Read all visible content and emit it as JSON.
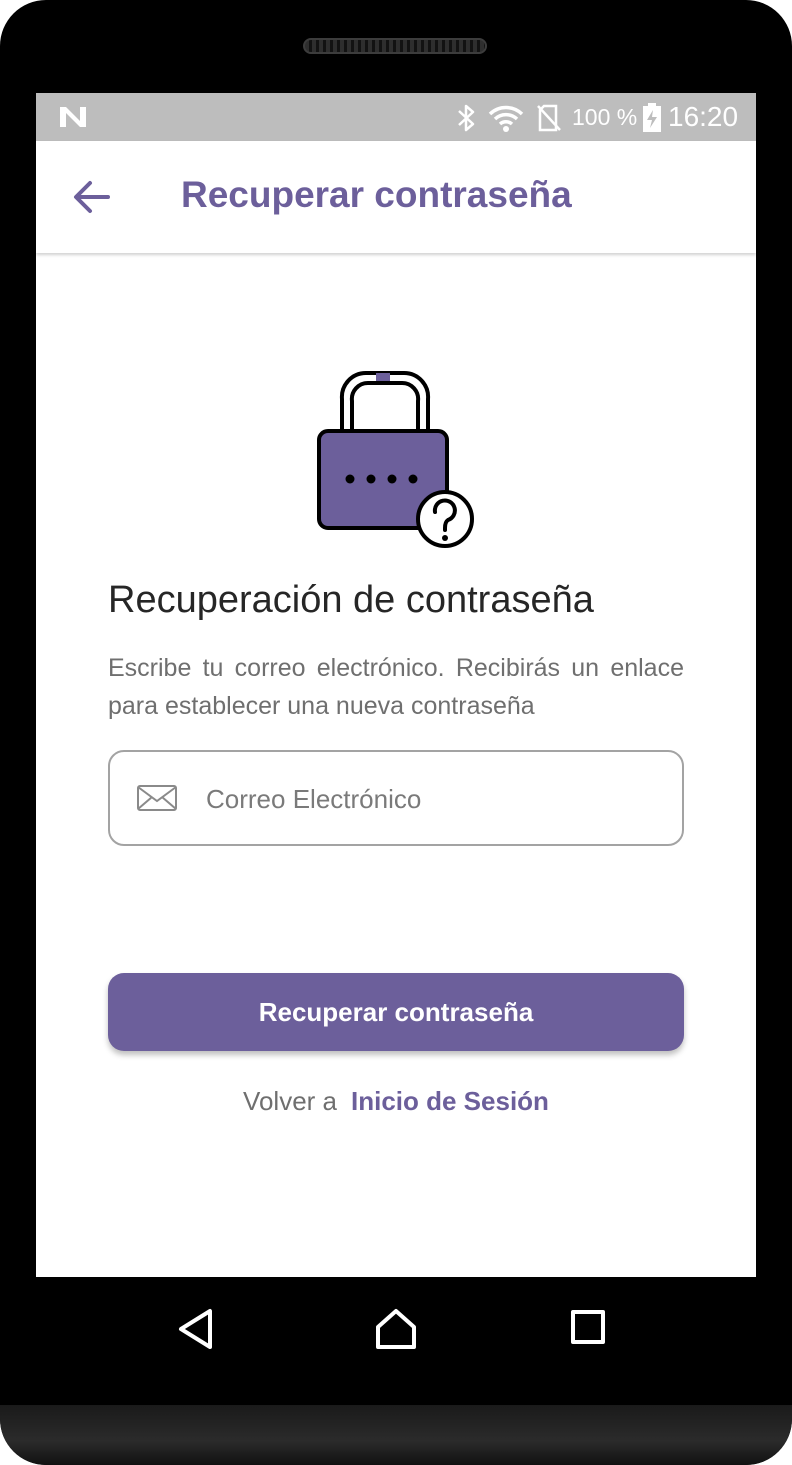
{
  "status_bar": {
    "battery_text": "100 %",
    "time": "16:20",
    "icons": [
      "n-notification-icon",
      "bluetooth-icon",
      "wifi-icon",
      "no-sim-icon",
      "battery-charging-icon"
    ]
  },
  "app_bar": {
    "title": "Recuperar contraseña",
    "back_icon": "arrow-left-icon"
  },
  "illustration": {
    "icon": "lock-question-icon",
    "color": "#6c5f9b"
  },
  "content": {
    "headline": "Recuperación de contraseña",
    "description": "Escribe tu correo electrónico. Recibirás un enlace para establecer una nueva contraseña"
  },
  "email_field": {
    "placeholder": "Correo Electrónico",
    "value": "",
    "icon": "mail-icon"
  },
  "submit_button": {
    "label": "Recuperar contraseña"
  },
  "footer": {
    "prefix": "Volver a",
    "link": "Inicio de Sesión"
  },
  "nav_bar": {
    "icons": [
      "back-triangle-icon",
      "home-icon",
      "recents-square-icon"
    ]
  },
  "colors": {
    "accent": "#6c5f9b",
    "status_bar": "#bdbdbd",
    "text_primary": "#262626",
    "text_secondary": "#6f6f6f"
  }
}
